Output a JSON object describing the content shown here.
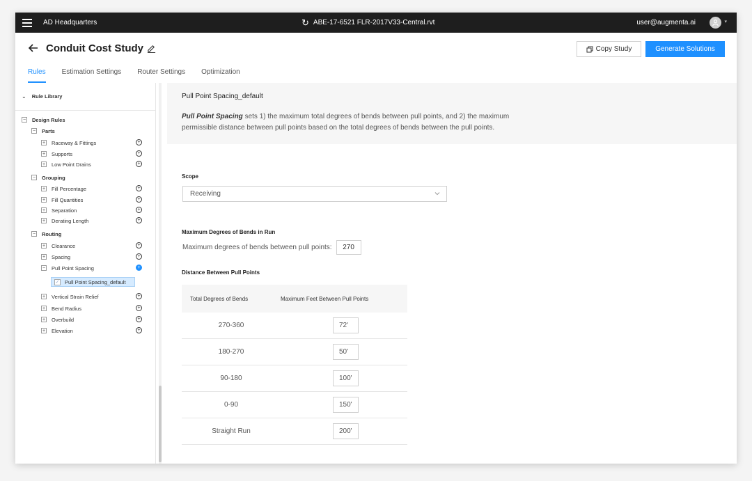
{
  "topbar": {
    "workspace": "AD Headquarters",
    "filename": "ABE-17-6521 FLR-2017V33-Central.rvt",
    "user": "user@augmenta.ai"
  },
  "header": {
    "title": "Conduit Cost Study",
    "copy_label": "Copy Study",
    "generate_label": "Generate Solutions"
  },
  "tabs": [
    {
      "label": "Rules",
      "active": true
    },
    {
      "label": "Estimation Settings"
    },
    {
      "label": "Router Settings"
    },
    {
      "label": "Optimization"
    }
  ],
  "sidebar": {
    "library_label": "Rule Library",
    "design_rules": "Design Rules",
    "groups": [
      {
        "label": "Parts",
        "items": [
          "Raceway & Fittings",
          "Supports",
          "Low Point Drains"
        ]
      },
      {
        "label": "Grouping",
        "items": [
          "Fill Percentage",
          "Fill Quantities",
          "Separation",
          "Derating Length"
        ]
      },
      {
        "label": "Routing",
        "items": [
          "Clearance",
          "Spacing",
          "Pull Point Spacing",
          "Vertical Strain Relief",
          "Bend Radius",
          "Overbuild",
          "Elevation"
        ]
      }
    ],
    "selected_child": "Pull Point Spacing_default"
  },
  "main": {
    "rule_title": "Pull Point Spacing_default",
    "rule_name": "Pull Point Spacing",
    "rule_desc": " sets 1) the maximum total degrees of bends between pull points, and 2) the maximum permissible distance between pull points based on the total degrees of bends between the pull points.",
    "scope_label": "Scope",
    "scope_value": "Receiving",
    "max_bends_label": "Maximum Degrees of Bends in Run",
    "max_bends_text": "Maximum degrees of bends between pull points:",
    "max_bends_value": "270",
    "distance_label": "Distance Between Pull Points",
    "table": {
      "headers": [
        "Total Degrees of Bends",
        "Maximum Feet Between Pull Points"
      ],
      "rows": [
        [
          "270-360",
          "72'"
        ],
        [
          "180-270",
          "50'"
        ],
        [
          "90-180",
          "100'"
        ],
        [
          "0-90",
          "150'"
        ],
        [
          "Straight Run",
          "200'"
        ]
      ]
    }
  }
}
